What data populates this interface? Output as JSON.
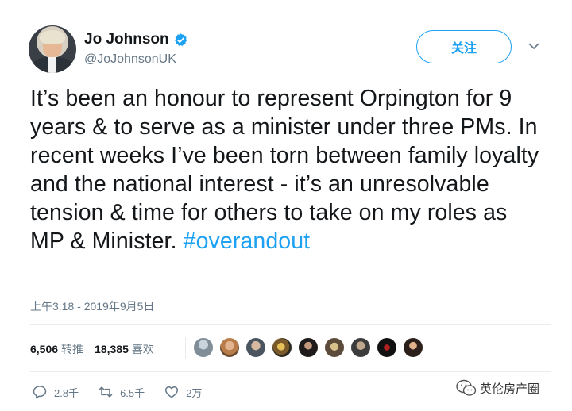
{
  "user": {
    "name": "Jo Johnson",
    "handle": "@JoJohnsonUK",
    "verified_icon": "verified-badge-icon"
  },
  "follow_label": "关注",
  "tweet": {
    "text": "It’s been an honour to represent Orpington for 9 years & to serve as a minister under three PMs. In recent weeks I’ve been torn between family loyalty and the national interest - it’s an unresolvable tension & time for others to take on my roles as MP & Minister.",
    "hashtag": "#overandout"
  },
  "timestamp": "上午3:18 - 2019年9月5日",
  "stats": {
    "retweets_count": "6,506",
    "retweets_label": "转推",
    "likes_count": "18,385",
    "likes_label": "喜欢"
  },
  "actions": {
    "reply_count": "2.8千",
    "retweet_count": "6.5千",
    "like_count": "2万"
  },
  "watermark": "英伦房产圈",
  "colors": {
    "accent": "#1da1f2",
    "text": "#14171a",
    "muted": "#657786"
  }
}
